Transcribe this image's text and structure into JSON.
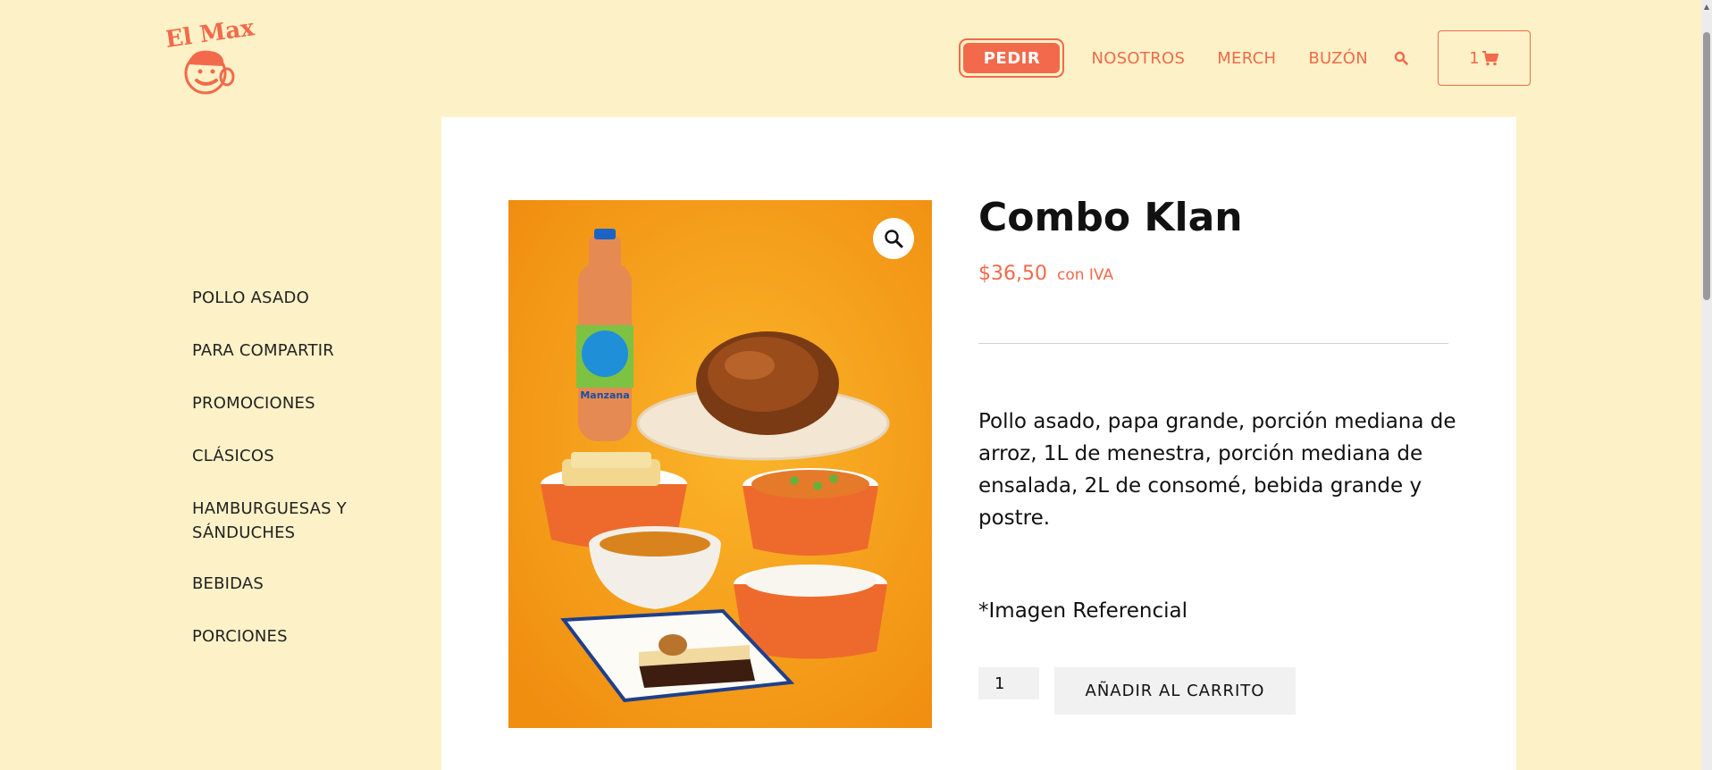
{
  "brand": {
    "logo_text": "El Max"
  },
  "nav": {
    "pedir": "PEDIR",
    "links": [
      "NOSOTROS",
      "MERCH",
      "BUZÓN"
    ],
    "cart_count": "1"
  },
  "sidebar": {
    "items": [
      "POLLO ASADO",
      "PARA COMPARTIR",
      "PROMOCIONES",
      "CLÁSICOS",
      "HAMBURGUESAS Y SÁNDUCHES",
      "BEBIDAS",
      "PORCIONES"
    ]
  },
  "product": {
    "title": "Combo Klan",
    "price": "$36,50",
    "tax_label": "con IVA",
    "description": "Pollo asado, papa grande, porción mediana de arroz, 1L de menestra, porción mediana de ensalada, 2L de consomé, bebida grande y postre.",
    "note": "*Imagen Referencial",
    "quantity": "1",
    "add_to_cart": "AÑADIR AL CARRITO",
    "bottle_label": "Manzana"
  },
  "colors": {
    "accent": "#f26a4b",
    "background": "#fdf1c7",
    "image_bg": "#f7a21b"
  },
  "icons": [
    "search-icon",
    "cart-icon",
    "zoom-icon"
  ]
}
